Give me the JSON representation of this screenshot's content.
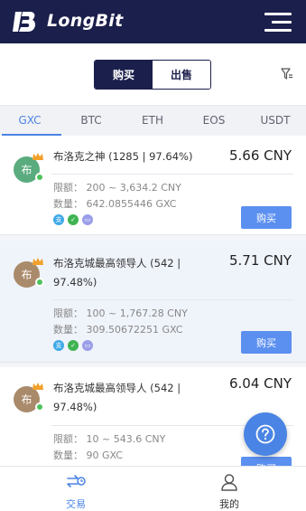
{
  "header": {
    "app_name": "LongBit",
    "menu_icon": "hamburger-menu-icon"
  },
  "trade_toggle": {
    "buy_label": "购买",
    "sell_label": "出售",
    "active": "buy"
  },
  "filter_icon": "filter-icon",
  "tabs": [
    {
      "label": "GXC",
      "active": true
    },
    {
      "label": "BTC",
      "active": false
    },
    {
      "label": "ETH",
      "active": false
    },
    {
      "label": "EOS",
      "active": false
    },
    {
      "label": "USDT",
      "active": false
    }
  ],
  "listings": [
    {
      "avatar_char": "布",
      "avatar_color": "#5aab7e",
      "merchant_text": "布洛克之神 (1285 | 97.64%)",
      "price": "5.66 CNY",
      "limit_label": "限额：",
      "limit_value": "200 ~ 3,634.2 CNY",
      "quantity_label": "数量：",
      "quantity_value": "642.0855446 GXC",
      "payment_icons": [
        "alipay-icon",
        "wechat-pay-icon",
        "bank-card-icon"
      ],
      "buy_label": "购买"
    },
    {
      "avatar_char": "布",
      "avatar_color": "#a98a6a",
      "merchant_text": "布洛克城最高领导人 (542 | 97.48%)",
      "price": "5.71 CNY",
      "limit_label": "限额：",
      "limit_value": "100 ~ 1,767.28 CNY",
      "quantity_label": "数量：",
      "quantity_value": "309.50672251 GXC",
      "payment_icons": [
        "alipay-icon",
        "wechat-pay-icon",
        "bank-card-icon"
      ],
      "buy_label": "购买"
    },
    {
      "avatar_char": "布",
      "avatar_color": "#a98a6a",
      "merchant_text": "布洛克城最高领导人 (542 | 97.48%)",
      "price": "6.04 CNY",
      "limit_label": "限额：",
      "limit_value": "10 ~ 543.6 CNY",
      "quantity_label": "数量：",
      "quantity_value": "90 GXC",
      "payment_icons": [],
      "buy_label": "购买"
    }
  ],
  "help_icon": "help-question-icon",
  "bottom_nav": [
    {
      "label": "交易",
      "icon": "trade-exchange-icon",
      "active": true
    },
    {
      "label": "我的",
      "icon": "user-profile-icon",
      "active": false
    }
  ],
  "colors": {
    "header_bg": "#1b1f4b",
    "accent": "#4a84e4",
    "button": "#5b8ff0"
  }
}
